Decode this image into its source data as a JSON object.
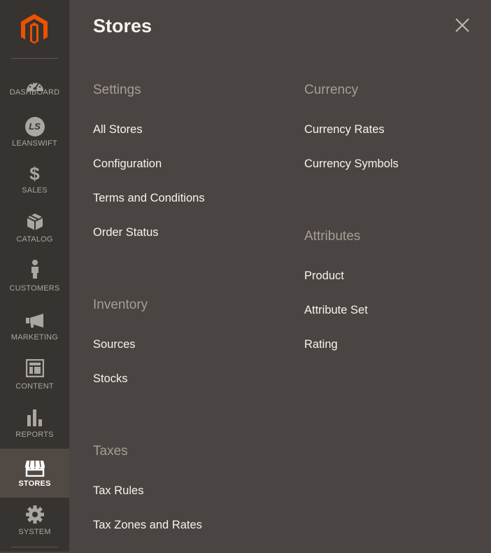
{
  "sidebar": {
    "items": [
      {
        "label": "DASHBOARD",
        "icon": "dashboard-icon"
      },
      {
        "label": "LEANSWIFT",
        "icon": "leanswift-icon",
        "badge": "LS"
      },
      {
        "label": "SALES",
        "icon": "dollar-icon",
        "glyph": "$"
      },
      {
        "label": "CATALOG",
        "icon": "box-icon"
      },
      {
        "label": "CUSTOMERS",
        "icon": "person-icon"
      },
      {
        "label": "MARKETING",
        "icon": "megaphone-icon"
      },
      {
        "label": "CONTENT",
        "icon": "layout-icon"
      },
      {
        "label": "REPORTS",
        "icon": "bar-chart-icon"
      },
      {
        "label": "STORES",
        "icon": "storefront-icon",
        "active": true
      },
      {
        "label": "SYSTEM",
        "icon": "gear-icon"
      }
    ]
  },
  "panel": {
    "title": "Stores",
    "close_icon": "close-icon",
    "sections": {
      "settings": {
        "title": "Settings",
        "links": [
          "All Stores",
          "Configuration",
          "Terms and Conditions",
          "Order Status"
        ]
      },
      "inventory": {
        "title": "Inventory",
        "links": [
          "Sources",
          "Stocks"
        ]
      },
      "taxes": {
        "title": "Taxes",
        "links": [
          "Tax Rules",
          "Tax Zones and Rates"
        ]
      },
      "currency": {
        "title": "Currency",
        "links": [
          "Currency Rates",
          "Currency Symbols"
        ]
      },
      "attributes": {
        "title": "Attributes",
        "links": [
          "Product",
          "Attribute Set",
          "Rating"
        ]
      }
    }
  },
  "colors": {
    "sidebar_bg": "#373330",
    "panel_bg": "#4a4542",
    "active_item_bg": "#514943",
    "logo_orange": "#eb5202",
    "section_title": "#a79d95",
    "link_text": "#f7f3eb"
  }
}
